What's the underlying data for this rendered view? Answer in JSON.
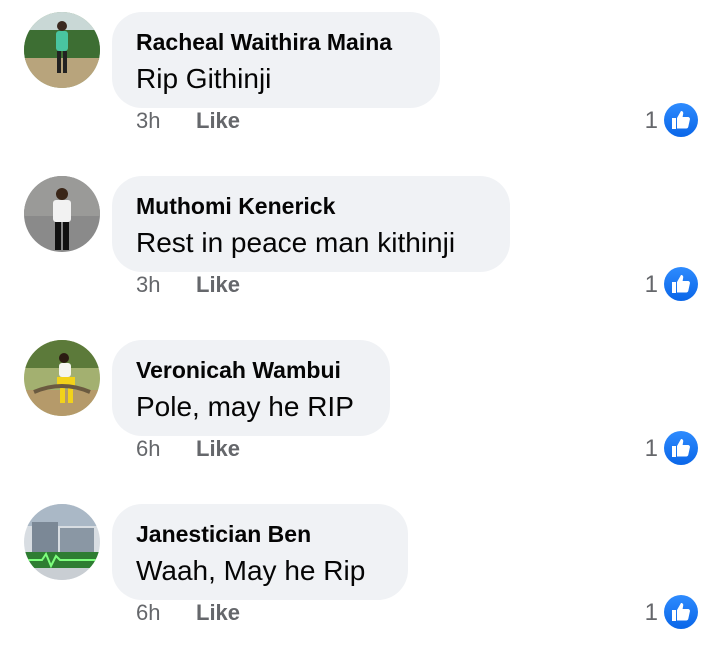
{
  "comments": [
    {
      "author": "Racheal Waithira Maina",
      "text": "Rip Githinji",
      "time": "3h",
      "like_label": "Like",
      "reaction_count": "1"
    },
    {
      "author": "Muthomi Kenerick",
      "text": "Rest in peace man kithinji",
      "time": "3h",
      "like_label": "Like",
      "reaction_count": "1"
    },
    {
      "author": "Veronicah Wambui",
      "text": "Pole, may he RIP",
      "time": "6h",
      "like_label": "Like",
      "reaction_count": "1"
    },
    {
      "author": "Janestician Ben",
      "text": "Waah, May he Rip",
      "time": "6h",
      "like_label": "Like",
      "reaction_count": "1"
    }
  ],
  "icons": {
    "reaction": "thumbs-up-like-icon"
  },
  "colors": {
    "bubble": "#f0f2f5",
    "meta_text": "#65676b",
    "like_badge": "#1877f2",
    "text": "#050505"
  }
}
